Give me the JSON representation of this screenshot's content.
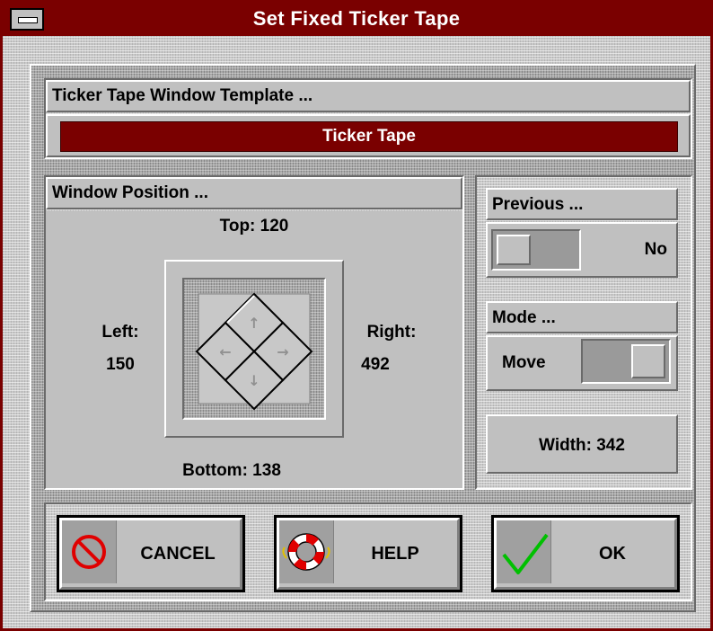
{
  "window": {
    "title": "Set Fixed Ticker Tape"
  },
  "template": {
    "header": "Ticker Tape Window Template ...",
    "value": "Ticker Tape"
  },
  "position": {
    "header": "Window Position ...",
    "top_label": "Top: 120",
    "left_label": "Left:",
    "left_value": "150",
    "right_label": "Right:",
    "right_value": "492",
    "bottom_label": "Bottom: 138",
    "arrows": {
      "up": "↑",
      "left": "←",
      "right": "→",
      "down": "↓"
    }
  },
  "previous": {
    "header": "Previous ...",
    "value": "No"
  },
  "mode": {
    "header": "Mode ...",
    "value": "Move"
  },
  "width": {
    "label": "Width: 342"
  },
  "buttons": {
    "cancel": {
      "label": "CANCEL",
      "icon": "no-entry-icon"
    },
    "help": {
      "label": "HELP",
      "icon": "life-ring-icon"
    },
    "ok": {
      "label": "OK",
      "icon": "checkmark-icon"
    }
  },
  "colors": {
    "title_bar": "#7a0000",
    "template_bar": "#7a0000",
    "check_green": "#00c000",
    "no_entry_red": "#e00000"
  }
}
